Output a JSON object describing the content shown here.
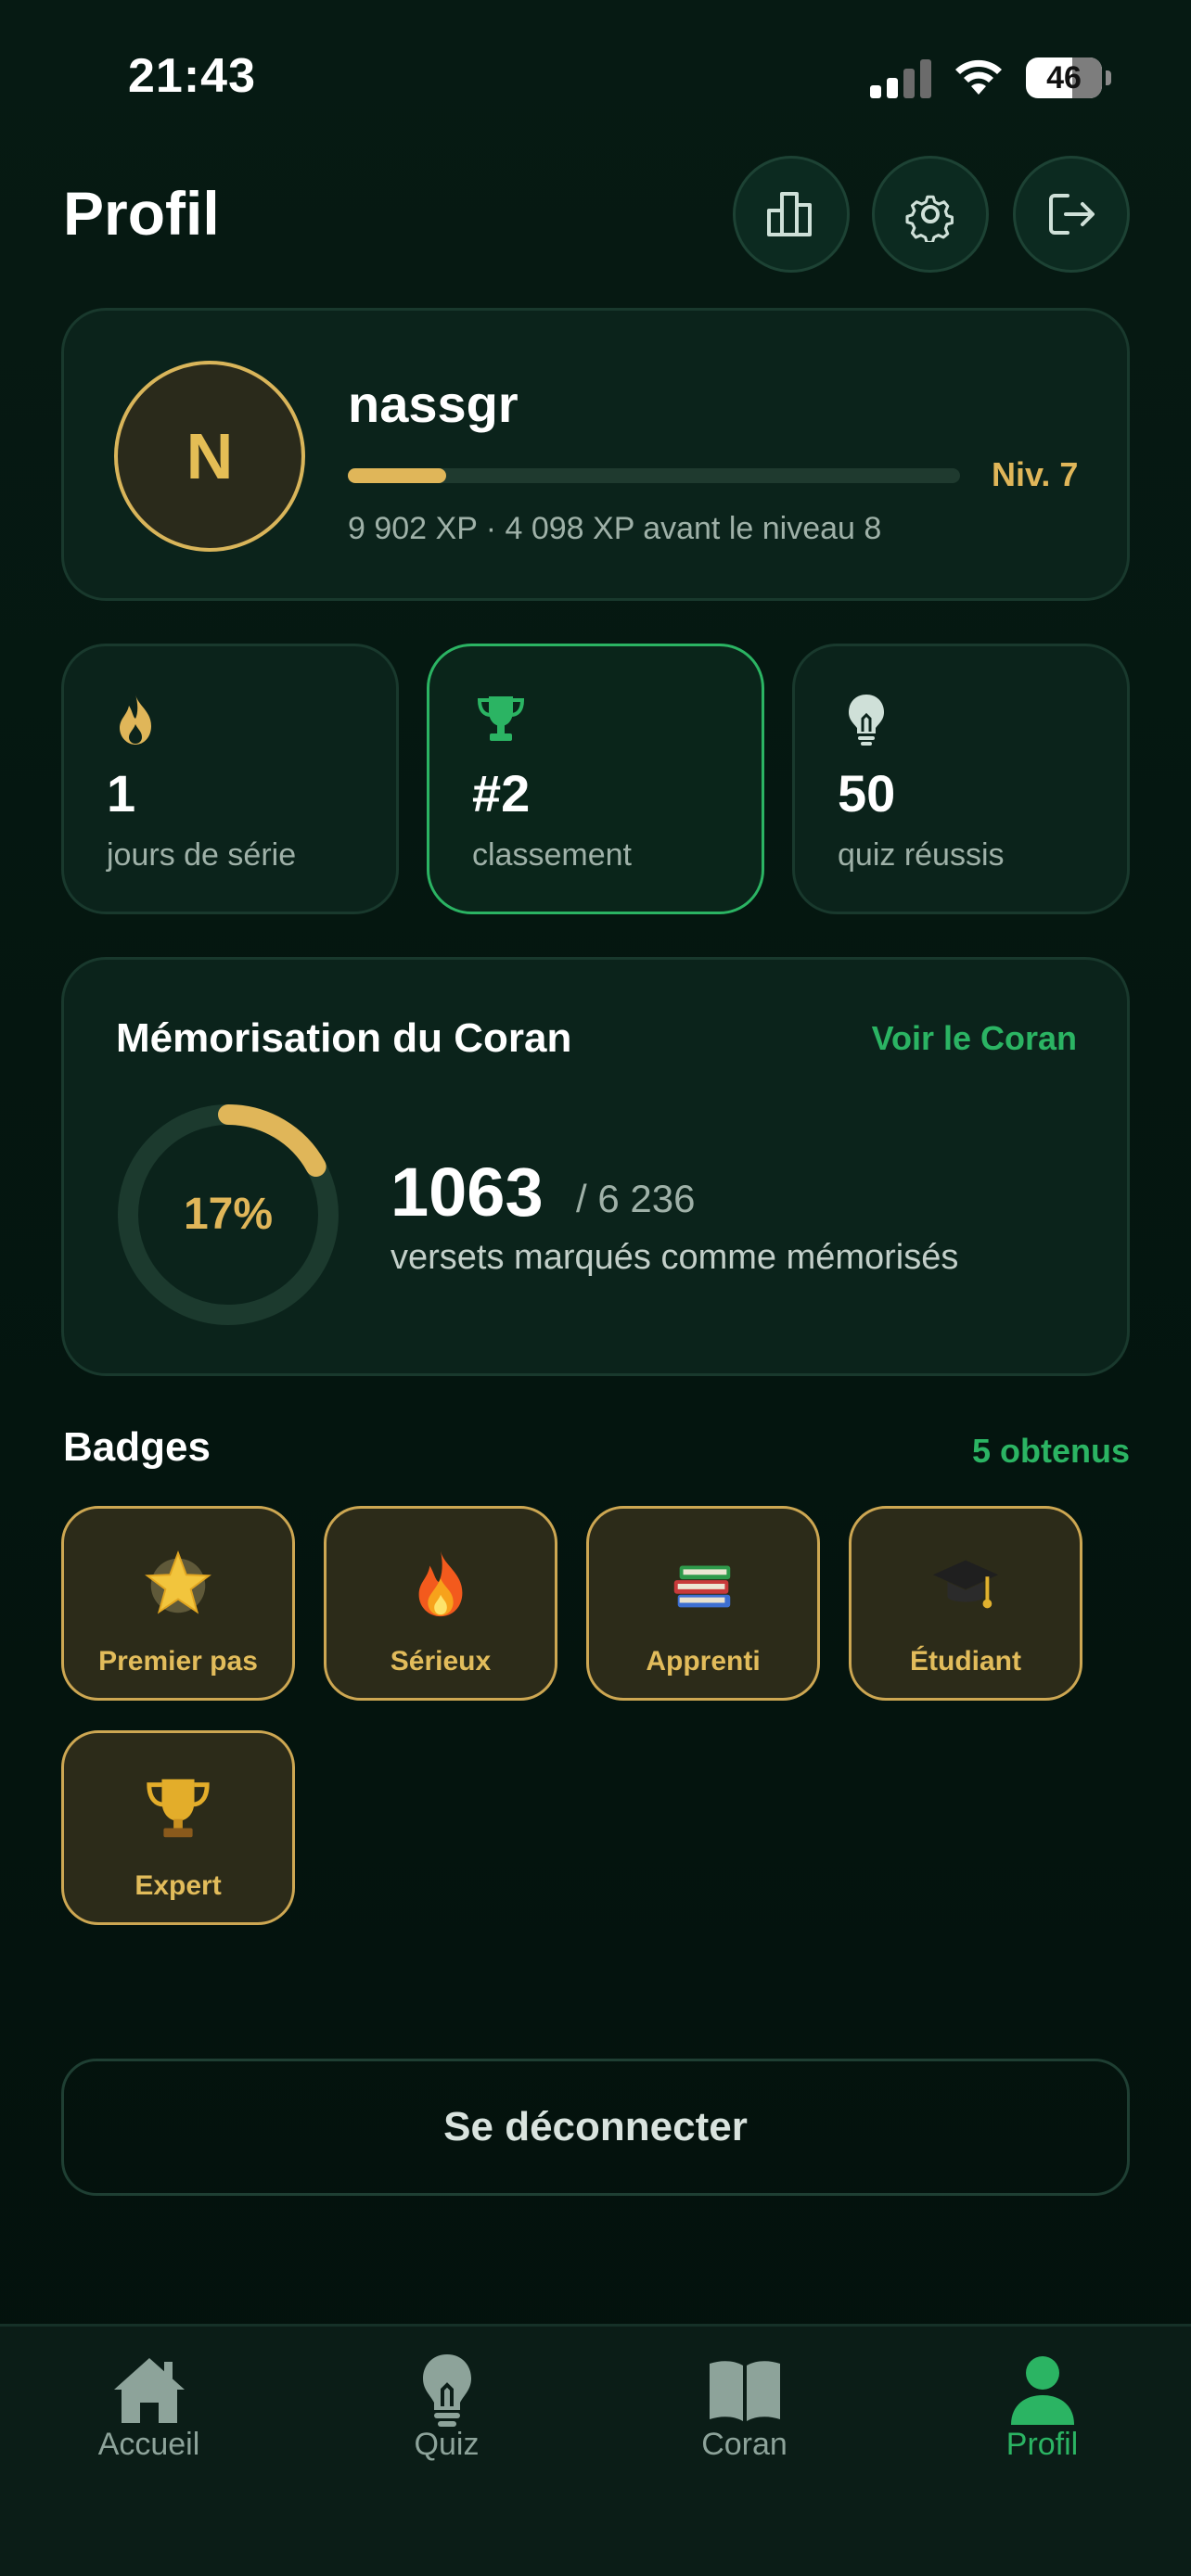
{
  "status_bar": {
    "time": "21:43",
    "battery": "46"
  },
  "header": {
    "title": "Profil"
  },
  "profile": {
    "initial": "N",
    "username": "nassgr",
    "level_label": "Niv. 7",
    "xp_progress_percent": 16,
    "xp_text": "9 902 XP · 4 098 XP avant le niveau 8"
  },
  "stats": [
    {
      "icon": "flame-icon",
      "value": "1",
      "label": "jours de série"
    },
    {
      "icon": "trophy-icon",
      "value": "#2",
      "label": "classement"
    },
    {
      "icon": "lightbulb-icon",
      "value": "50",
      "label": "quiz réussis"
    }
  ],
  "memorization": {
    "title": "Mémorisation du Coran",
    "link": "Voir le Coran",
    "percent_label": "17%",
    "percent": 17,
    "count": "1063",
    "total": "/ 6 236",
    "caption": "versets marqués comme mémorisés"
  },
  "badges": {
    "title": "Badges",
    "count_label": "5 obtenus",
    "items": [
      {
        "icon": "star-icon",
        "label": "Premier pas"
      },
      {
        "icon": "fire-icon",
        "label": "Sérieux"
      },
      {
        "icon": "books-icon",
        "label": "Apprenti"
      },
      {
        "icon": "graduation-cap-icon",
        "label": "Étudiant"
      },
      {
        "icon": "trophy-icon",
        "label": "Expert"
      }
    ]
  },
  "logout_label": "Se déconnecter",
  "nav": {
    "items": [
      {
        "label": "Accueil",
        "icon": "home-icon"
      },
      {
        "label": "Quiz",
        "icon": "lightbulb-icon"
      },
      {
        "label": "Coran",
        "icon": "book-icon"
      },
      {
        "label": "Profil",
        "icon": "person-icon",
        "active": true
      }
    ]
  },
  "colors": {
    "accent_green": "#2bb463",
    "accent_gold": "#e0b659",
    "background": "#061a13",
    "card": "#0b231b"
  }
}
